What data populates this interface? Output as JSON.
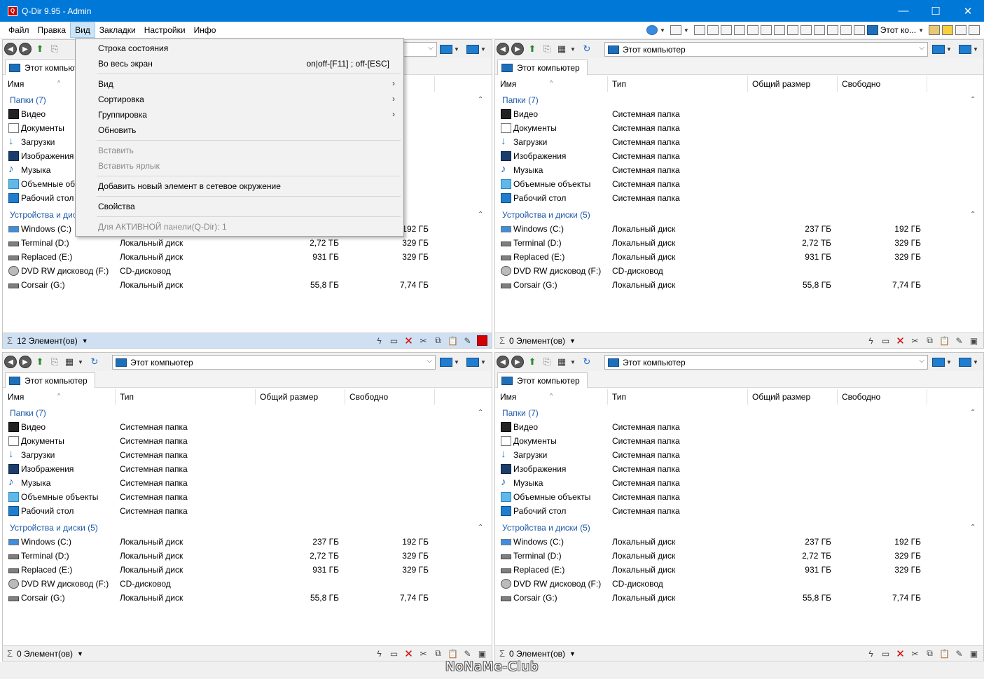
{
  "window": {
    "title": "Q-Dir 9.95 - Admin",
    "icon_letter": "Q"
  },
  "window_buttons": {
    "minimize": "—",
    "maximize": "☐",
    "close": "✕"
  },
  "menu": [
    "Файл",
    "Правка",
    "Вид",
    "Закладки",
    "Настройки",
    "Инфо"
  ],
  "top_toolbar": {
    "address_short": "Этот ко..."
  },
  "dropdown": {
    "items": [
      {
        "label": "Строка состояния",
        "shortcut": "",
        "submenu": false,
        "disabled": false
      },
      {
        "label": "Во весь экран",
        "shortcut": "on|off-[F11] ; off-[ESC]",
        "submenu": false,
        "disabled": false
      },
      {
        "label": "Вид",
        "shortcut": "",
        "submenu": true,
        "disabled": false
      },
      {
        "label": "Сортировка",
        "shortcut": "",
        "submenu": true,
        "disabled": false
      },
      {
        "label": "Группировка",
        "shortcut": "",
        "submenu": true,
        "disabled": false
      },
      {
        "label": "Обновить",
        "shortcut": "",
        "submenu": false,
        "disabled": false
      },
      {
        "label": "Вставить",
        "shortcut": "",
        "submenu": false,
        "disabled": true
      },
      {
        "label": "Вставить ярлык",
        "shortcut": "",
        "submenu": false,
        "disabled": true
      },
      {
        "label": "Добавить новый элемент в сетевое окружение",
        "shortcut": "",
        "submenu": false,
        "disabled": false
      },
      {
        "label": "Свойства",
        "shortcut": "",
        "submenu": false,
        "disabled": false
      },
      {
        "label": "Для АКТИВНОЙ панели(Q-Dir): 1",
        "shortcut": "",
        "submenu": false,
        "disabled": true
      }
    ],
    "submenu_arrow": "›"
  },
  "pane": {
    "address": "Этот компьютер",
    "tab": "Этот компьютер",
    "columns": {
      "name": "Имя",
      "type": "Тип",
      "total": "Общий размер",
      "free": "Свободно"
    },
    "folders_group": "Папки (7)",
    "devices_group": "Устройства и диски (5)",
    "folders": [
      {
        "name": "Видео",
        "type": "Системная папка",
        "icon": "video-icon"
      },
      {
        "name": "Документы",
        "type": "Системная папка",
        "icon": "documents-icon"
      },
      {
        "name": "Загрузки",
        "type": "Системная папка",
        "icon": "downloads-icon"
      },
      {
        "name": "Изображения",
        "type": "Системная папка",
        "icon": "pictures-icon"
      },
      {
        "name": "Музыка",
        "type": "Системная папка",
        "icon": "music-icon"
      },
      {
        "name": "Объемные объекты",
        "type": "Системная папка",
        "icon": "3d-objects-icon"
      },
      {
        "name": "Рабочий стол",
        "type": "Системная папка",
        "icon": "desktop-icon"
      }
    ],
    "drives": [
      {
        "name": "Windows (C:)",
        "type": "Локальный диск",
        "total": "237 ГБ",
        "free": "192 ГБ",
        "icon": "windows-drive-icon"
      },
      {
        "name": "Terminal (D:)",
        "type": "Локальный диск",
        "total": "2,72 ТБ",
        "free": "329 ГБ",
        "icon": "hdd-icon"
      },
      {
        "name": "Replaced (E:)",
        "type": "Локальный диск",
        "total": "931 ГБ",
        "free": "329 ГБ",
        "icon": "hdd-icon"
      },
      {
        "name": "DVD RW дисковод (F:)",
        "type": "CD-дисковод",
        "total": "",
        "free": "",
        "icon": "dvd-icon"
      },
      {
        "name": "Corsair (G:)",
        "type": "Локальный диск",
        "total": "55,8 ГБ",
        "free": "7,74 ГБ",
        "icon": "hdd-icon"
      }
    ]
  },
  "status": {
    "pane1": "12 Элемент(ов)",
    "pane2": "0 Элемент(ов)",
    "pane3": "0 Элемент(ов)",
    "pane4": "0 Элемент(ов)",
    "sigma": "Σ"
  },
  "watermark": "NoNaMe-Club",
  "colors": {
    "titlebar": "#0078d7",
    "group": "#1e5aa8",
    "active_status": "#cfe0f3",
    "delete_red": "#d40000"
  }
}
